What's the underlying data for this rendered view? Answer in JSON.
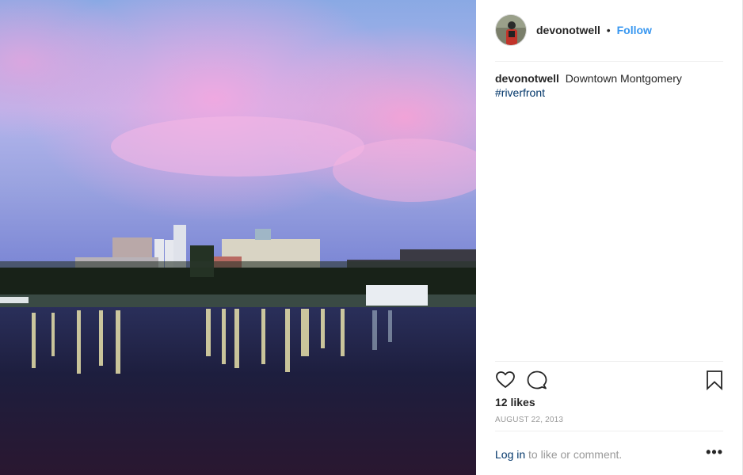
{
  "post": {
    "photo_name": "riverfront-photo",
    "author": {
      "username": "devonotwell",
      "separator": "•",
      "follow_label": "Follow"
    },
    "caption": {
      "username": "devonotwell",
      "text": "Downtown Montgomery",
      "hashtag": "#riverfront"
    },
    "actions": {
      "like_icon": "heart-icon",
      "comment_icon": "comment-icon",
      "save_icon": "bookmark-icon"
    },
    "likes_text": "12 likes",
    "date": "AUGUST 22, 2013",
    "footer": {
      "login_link": "Log in",
      "login_suffix": "to like or comment.",
      "more_label": "•••"
    }
  },
  "colors": {
    "link_blue": "#3897f0",
    "hashtag_blue": "#003569",
    "muted_gray": "#999999"
  }
}
